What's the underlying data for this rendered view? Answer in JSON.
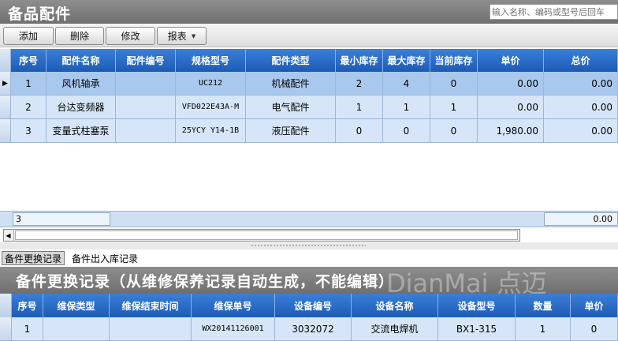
{
  "title": "备品配件",
  "search": {
    "placeholder": "输入名称、编码或型号后回车"
  },
  "toolbar": {
    "add": "添加",
    "delete": "删除",
    "edit": "修改",
    "report": "报表"
  },
  "parts_table": {
    "columns": [
      "序号",
      "配件名称",
      "配件编号",
      "规格型号",
      "配件类型",
      "最小库存",
      "最大库存",
      "当前库存",
      "单价",
      "总价"
    ],
    "rows": [
      [
        "1",
        "风机轴承",
        "",
        "UC212",
        "机械配件",
        "2",
        "4",
        "0",
        "0.00",
        "0.00"
      ],
      [
        "2",
        "台达变频器",
        "",
        "VFD022E43A-M",
        "电气配件",
        "1",
        "1",
        "1",
        "0.00",
        "0.00"
      ],
      [
        "3",
        "变量式柱塞泵",
        "",
        "25YCY Y14-1B",
        "液压配件",
        "0",
        "0",
        "0",
        "1,980.00",
        "0.00"
      ]
    ],
    "footer": {
      "count": "3",
      "total": "0.00"
    }
  },
  "tabs": {
    "replace": "备件更换记录",
    "inout": "备件出入库记录"
  },
  "sub_title": "备件更换记录（从维修保养记录自动生成，不能编辑）",
  "watermark": "DianMai 点迈",
  "replace_table": {
    "columns": [
      "序号",
      "维保类型",
      "维保结束时间",
      "维保单号",
      "设备编号",
      "设备名称",
      "设备型号",
      "数量",
      "单价"
    ],
    "rows": [
      [
        "1",
        "",
        "",
        "WX20141126001",
        "3032072",
        "交流电焊机",
        "BX1-315",
        "1",
        "0"
      ]
    ]
  },
  "colors": {
    "header_blue": "#2a6cc8",
    "row_blue": "#a9c8ee",
    "row_light": "#d6e6f8",
    "title_gray": "#7d7d7d"
  }
}
